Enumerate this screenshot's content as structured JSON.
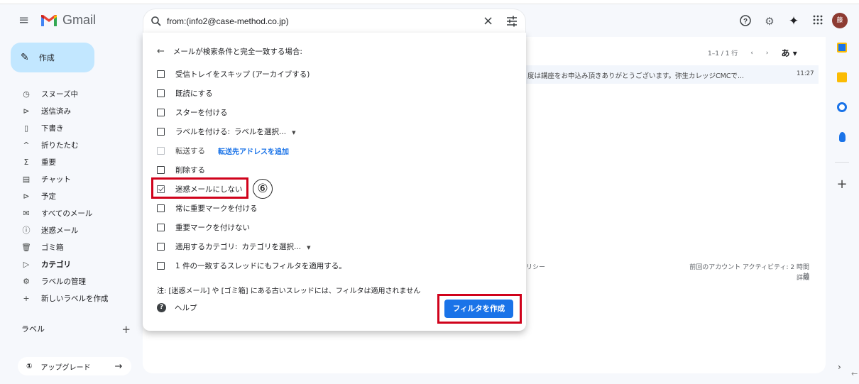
{
  "header": {
    "app_name": "Gmail",
    "search_value": "from:(info2@case-method.co.jp)",
    "avatar_letter": "藤"
  },
  "sidebar": {
    "compose_label": "作成",
    "items": [
      {
        "icon": "clock-icon",
        "glyph": "◷",
        "label": "スヌーズ中"
      },
      {
        "icon": "send-icon",
        "glyph": "⊳",
        "label": "送信済み"
      },
      {
        "icon": "draft-icon",
        "glyph": "▯",
        "label": "下書き"
      },
      {
        "icon": "collapse-icon",
        "glyph": "^",
        "label": "折りたたむ"
      },
      {
        "icon": "important-icon",
        "glyph": "Σ",
        "label": "重要"
      },
      {
        "icon": "chat-icon",
        "glyph": "▤",
        "label": "チャット"
      },
      {
        "icon": "scheduled-icon",
        "glyph": "⊳",
        "label": "予定"
      },
      {
        "icon": "all-mail-icon",
        "glyph": "✉",
        "label": "すべてのメール"
      },
      {
        "icon": "spam-icon",
        "glyph": "ⓘ",
        "label": "迷惑メール"
      },
      {
        "icon": "trash-icon",
        "glyph": "🗑",
        "label": "ゴミ箱"
      },
      {
        "icon": "category-icon",
        "glyph": "▷",
        "label": "カテゴリ"
      },
      {
        "icon": "gear-icon",
        "glyph": "⚙",
        "label": "ラベルの管理"
      },
      {
        "icon": "plus-icon",
        "glyph": "+",
        "label": "新しいラベルを作成"
      }
    ],
    "labels_header": "ラベル",
    "upgrade_label": "アップグレード"
  },
  "main": {
    "pager": "1–1 / 1 行",
    "input_lang": "あ",
    "mail_snippet": "度は講座をお申込み頂きありがとうございます。弥生カレッジCMCで...",
    "mail_time": "11:27",
    "footer_policy": "リシー",
    "footer_activity": "前回のアカウント アクティビティ: 2 時間前",
    "footer_detail": "詳細"
  },
  "filter": {
    "title": "メールが検索条件と完全一致する場合:",
    "options": [
      {
        "label": "受信トレイをスキップ (アーカイブする)",
        "checked": false
      },
      {
        "label": "既読にする",
        "checked": false
      },
      {
        "label": "スターを付ける",
        "checked": false
      },
      {
        "label": "ラベルを付ける:",
        "select": "ラベルを選択...",
        "checked": false
      },
      {
        "label": "転送する",
        "link": "転送先アドレスを追加",
        "checked": false,
        "disabled": true
      },
      {
        "label": "削除する",
        "checked": false
      },
      {
        "label": "迷惑メールにしない",
        "checked": true
      },
      {
        "label": "常に重要マークを付ける",
        "checked": false
      },
      {
        "label": "重要マークを付けない",
        "checked": false
      },
      {
        "label": "適用するカテゴリ:",
        "select": "カテゴリを選択...",
        "checked": false
      },
      {
        "label": "1 件の一致するスレッドにもフィルタを適用する。",
        "checked": false
      }
    ],
    "note": "注: [迷惑メール] や [ゴミ箱] にある古いスレッドには、フィルタは適用されません",
    "help_label": "ヘルプ",
    "create_button": "フィルタを作成",
    "annotation": "⑥"
  },
  "colors": {
    "accent": "#1a73e8",
    "compose_bg": "#c2e7ff",
    "highlight": "#d0021b"
  }
}
